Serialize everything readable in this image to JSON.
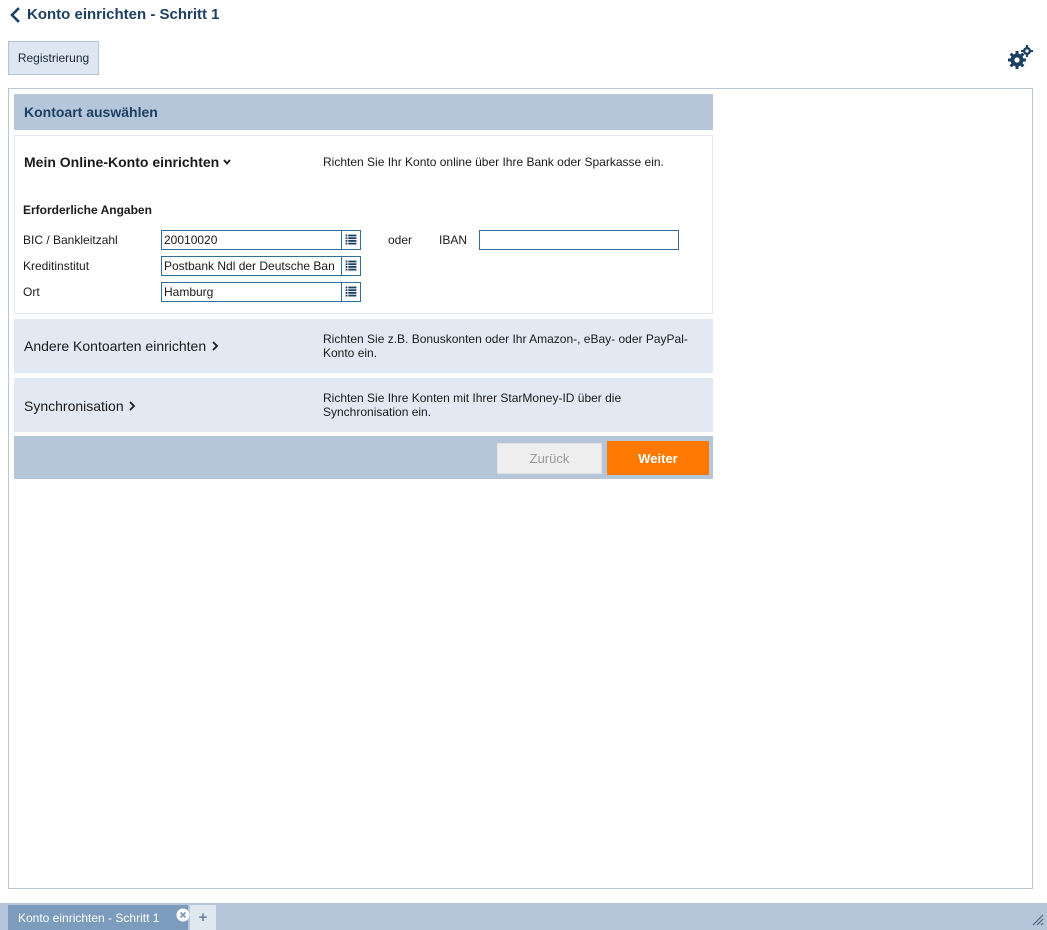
{
  "window": {
    "title": "Konto einrichten - Schritt 1"
  },
  "toolbar": {
    "registration_label": "Registrierung"
  },
  "icons": {
    "back": "chevron-left-icon",
    "settings": "gears-icon",
    "list_picker": "list-icon",
    "tab_close": "close-circle-icon",
    "resize": "resize-grip-icon"
  },
  "colors": {
    "title": "#1c3f63",
    "header_bg": "#b6c6da",
    "option_bg": "#e2e9f2",
    "input_border": "#2f6f9b",
    "primary_button": "#ff7900",
    "tab_active": "#7b9cbc"
  },
  "section": {
    "title": "Kontoart auswählen"
  },
  "online_account": {
    "title": "Mein Online-Konto einrichten",
    "description": "Richten Sie Ihr Konto online über Ihre Bank oder Sparkasse ein.",
    "required_title": "Erforderliche Angaben",
    "fields": {
      "bic": {
        "label": "BIC / Bankleitzahl",
        "value": "20010020"
      },
      "institute": {
        "label": "Kreditinstitut",
        "value": "Postbank Ndl der Deutsche Ban"
      },
      "city": {
        "label": "Ort",
        "value": "Hamburg"
      }
    },
    "or_label": "oder",
    "iban": {
      "label": "IBAN",
      "value": ""
    }
  },
  "other_accounts": {
    "title": "Andere Kontoarten einrichten",
    "description": "Richten Sie z.B. Bonuskonten oder Ihr Amazon-, eBay- oder PayPal-Konto ein."
  },
  "sync": {
    "title": "Synchronisation",
    "description": "Richten Sie Ihre Konten mit Ihrer StarMoney-ID über die Synchronisation ein."
  },
  "footer": {
    "back_label": "Zurück",
    "next_label": "Weiter"
  },
  "tabs": [
    {
      "label": "Konto einrichten - Schritt 1"
    }
  ],
  "tab_add_label": "+"
}
